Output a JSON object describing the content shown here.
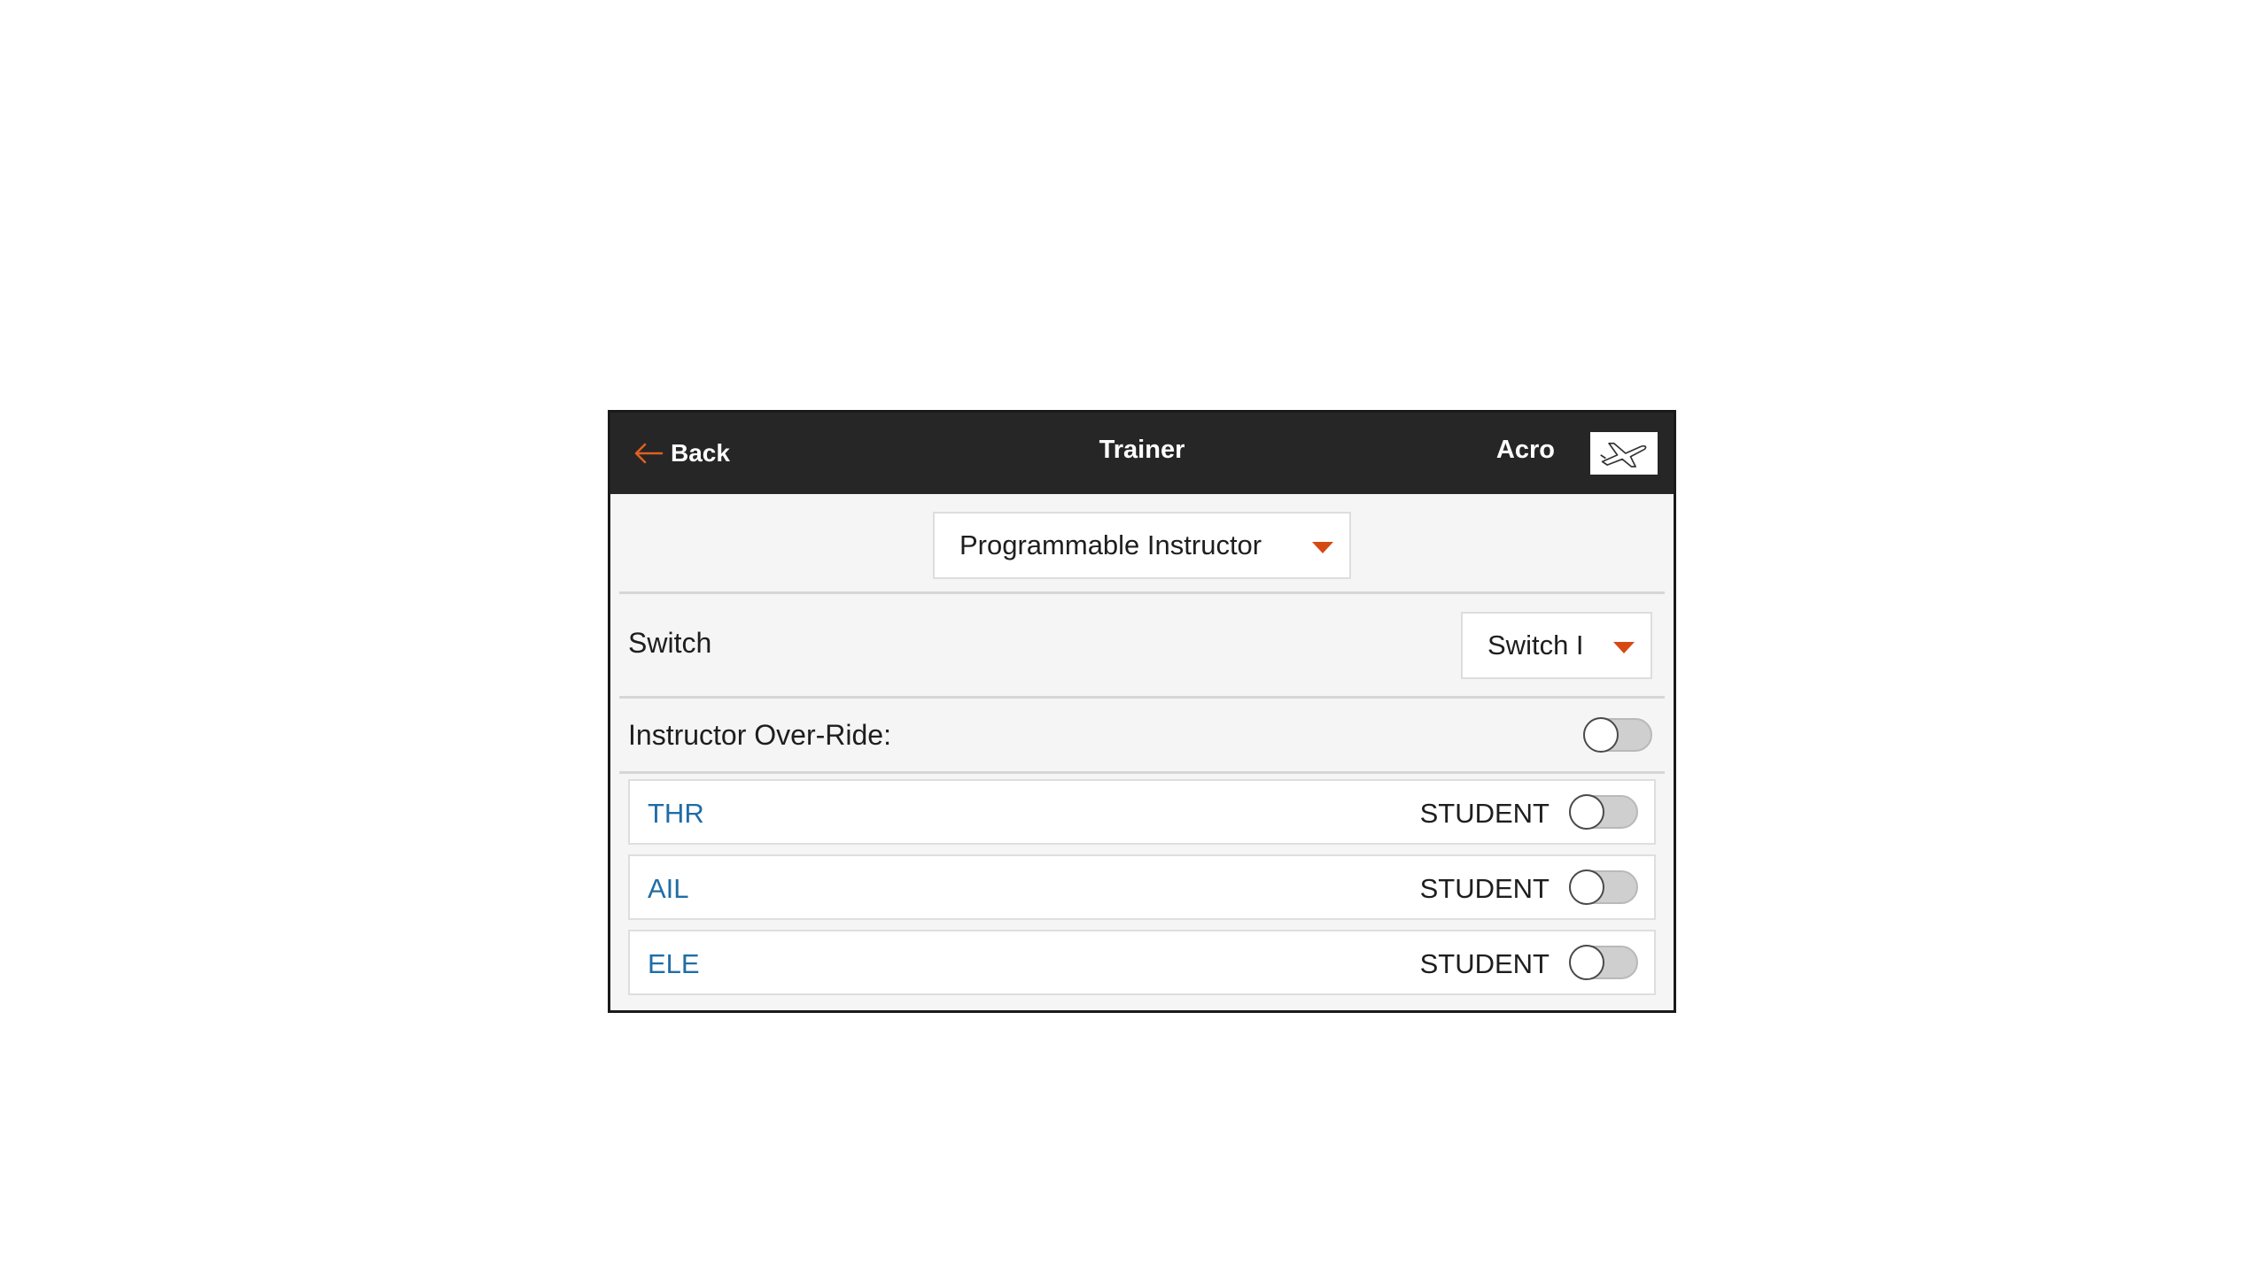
{
  "header": {
    "back_label": "Back",
    "title": "Trainer",
    "model_name": "Acro",
    "model_icon": "airplane-icon",
    "accent_color": "#d64a12"
  },
  "mode": {
    "selected": "Programmable Instructor"
  },
  "switch_row": {
    "label": "Switch",
    "selected": "Switch I"
  },
  "override_row": {
    "label": "Instructor Over-Ride:",
    "enabled": false
  },
  "channels": [
    {
      "name": "THR",
      "state": "STUDENT",
      "enabled": false
    },
    {
      "name": "AIL",
      "state": "STUDENT",
      "enabled": false
    },
    {
      "name": "ELE",
      "state": "STUDENT",
      "enabled": false
    }
  ]
}
